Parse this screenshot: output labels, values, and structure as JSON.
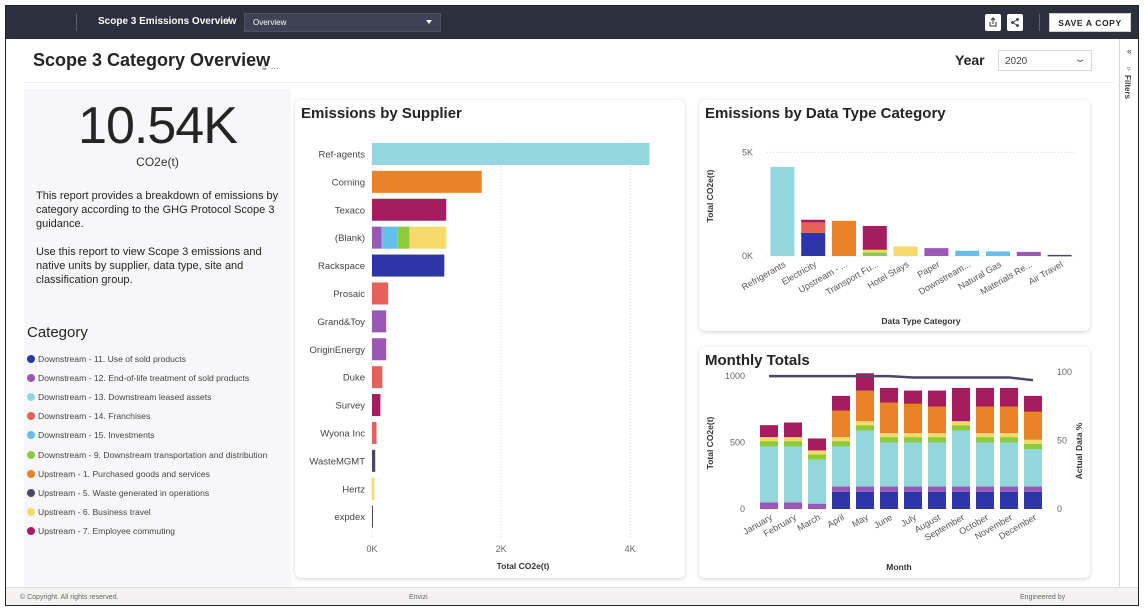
{
  "topbar": {
    "report_title": "Scope 3 Emissions Overview",
    "separator": "/",
    "page_select": "Overview",
    "save_label": "SAVE A COPY"
  },
  "page": {
    "title": "Scope 3 Category Overview",
    "year_label": "Year",
    "year_value": "2020"
  },
  "filters_pane": {
    "label": "Filters"
  },
  "kpi": {
    "value": "10.54K",
    "unit": "CO2e(t)"
  },
  "description": {
    "para1": "This report provides a breakdown of emissions by category according to the GHG Protocol Scope 3 guidance.",
    "para2": "Use this report to view Scope 3 emissions and native units by supplier, data type, site and classification group."
  },
  "category": {
    "title": "Category",
    "items": [
      {
        "label": "Downstream - 11. Use of sold products",
        "color": "#2e35a6"
      },
      {
        "label": "Downstream - 12. End-of-life treatment of sold products",
        "color": "#9b57b5"
      },
      {
        "label": "Downstream - 13. Downstream leased assets",
        "color": "#93d6de"
      },
      {
        "label": "Downstream - 14. Franchises",
        "color": "#e5625b"
      },
      {
        "label": "Downstream - 15. Investments",
        "color": "#64c0e8"
      },
      {
        "label": "Downstream - 9. Downstream transportation and distribution",
        "color": "#8ccc3c"
      },
      {
        "label": "Upstream - 1. Purchased goods and services",
        "color": "#e8832a"
      },
      {
        "label": "Upstream - 5. Waste generated in operations",
        "color": "#4b4866"
      },
      {
        "label": "Upstream - 6. Business travel",
        "color": "#f6d96b"
      },
      {
        "label": "Upstream - 7. Employee commuting",
        "color": "#a51d5f"
      }
    ]
  },
  "colors": {
    "d11": "#2e35a6",
    "d12": "#9b57b5",
    "d13": "#93d6de",
    "d14": "#e5625b",
    "d15": "#64c0e8",
    "d9": "#8ccc3c",
    "u1": "#e8832a",
    "u5": "#4b4866",
    "u6": "#f6d96b",
    "u7": "#a51d5f",
    "topbar": "#2b2f3e",
    "grid": "#d8d8d8",
    "line": "#4b4866"
  },
  "chart_data": [
    {
      "type": "bar",
      "orientation": "horizontal",
      "title": "Emissions by Supplier",
      "xlabel": "Total CO2e(t)",
      "xlim": [
        0,
        4500
      ],
      "xticks": [
        0,
        2000,
        4000
      ],
      "xtick_labels": [
        "0K",
        "2K",
        "4K"
      ],
      "categories": [
        "Ref-agents",
        "Corning",
        "Texaco",
        "(Blank)",
        "Rackspace",
        "Prosaic",
        "Grand&Toy",
        "OriginEnergy",
        "Duke",
        "Survey",
        "Wyona Inc",
        "WasteMGMT",
        "Hertz",
        "expdex"
      ],
      "segments": [
        [
          {
            "cat": "d13",
            "value": 4300
          }
        ],
        [
          {
            "cat": "u1",
            "value": 1700
          }
        ],
        [
          {
            "cat": "u7",
            "value": 1150
          }
        ],
        [
          {
            "cat": "d12",
            "value": 150
          },
          {
            "cat": "d15",
            "value": 250
          },
          {
            "cat": "d9",
            "value": 180
          },
          {
            "cat": "u6",
            "value": 570
          }
        ],
        [
          {
            "cat": "d11",
            "value": 1120
          }
        ],
        [
          {
            "cat": "d14",
            "value": 250
          }
        ],
        [
          {
            "cat": "d12",
            "value": 220
          }
        ],
        [
          {
            "cat": "d12",
            "value": 220
          }
        ],
        [
          {
            "cat": "d14",
            "value": 160
          }
        ],
        [
          {
            "cat": "u7",
            "value": 130
          }
        ],
        [
          {
            "cat": "d14",
            "value": 70
          }
        ],
        [
          {
            "cat": "u5",
            "value": 50
          }
        ],
        [
          {
            "cat": "u6",
            "value": 35
          }
        ],
        [
          {
            "cat": "u5",
            "value": 5
          }
        ]
      ]
    },
    {
      "type": "bar",
      "orientation": "vertical",
      "title": "Emissions by Data Type Category",
      "xlabel": "Data Type Category",
      "ylabel": "Total CO2e(t)",
      "ylim": [
        0,
        5500
      ],
      "yticks": [
        0,
        5000
      ],
      "ytick_labels": [
        "0K",
        "5K"
      ],
      "categories": [
        "Refrigerants",
        "Electricity",
        "Upstream - ...",
        "Transport Fu...",
        "Hotel Stays",
        "Paper",
        "Downstream...",
        "Natural Gas",
        "Materials Re...",
        "Air Travel"
      ],
      "segments": [
        [
          {
            "cat": "d13",
            "value": 4300
          }
        ],
        [
          {
            "cat": "d11",
            "value": 1120
          },
          {
            "cat": "d14",
            "value": 500
          },
          {
            "cat": "u7",
            "value": 130
          }
        ],
        [
          {
            "cat": "u1",
            "value": 1700
          }
        ],
        [
          {
            "cat": "d9",
            "value": 180
          },
          {
            "cat": "u6",
            "value": 120
          },
          {
            "cat": "u7",
            "value": 1150
          }
        ],
        [
          {
            "cat": "u6",
            "value": 460
          }
        ],
        [
          {
            "cat": "d12",
            "value": 380
          }
        ],
        [
          {
            "cat": "d15",
            "value": 250
          }
        ],
        [
          {
            "cat": "d15",
            "value": 220
          }
        ],
        [
          {
            "cat": "d12",
            "value": 200
          }
        ],
        [
          {
            "cat": "u5",
            "value": 55
          }
        ]
      ]
    },
    {
      "type": "bar",
      "subtype": "stacked-with-line",
      "title": "Monthly Totals",
      "xlabel": "Month",
      "ylabel": "Total CO2e(t)",
      "y2label": "Actual Data %",
      "ylim": [
        0,
        1200
      ],
      "yticks": [
        0,
        500,
        1000
      ],
      "y2lim": [
        0,
        110
      ],
      "y2ticks": [
        0,
        50,
        100
      ],
      "categories": [
        "January",
        "February",
        "March",
        "April",
        "May",
        "June",
        "July",
        "August",
        "September",
        "October",
        "November",
        "December"
      ],
      "stack_order": [
        "d11",
        "d12",
        "d13",
        "d9",
        "u6",
        "u1",
        "u7"
      ],
      "series": [
        {
          "cat": "d11",
          "values": [
            0,
            0,
            0,
            130,
            130,
            130,
            130,
            130,
            130,
            130,
            130,
            130
          ]
        },
        {
          "cat": "d12",
          "values": [
            50,
            50,
            40,
            40,
            40,
            40,
            40,
            40,
            40,
            40,
            40,
            40
          ]
        },
        {
          "cat": "d13",
          "values": [
            420,
            420,
            330,
            300,
            420,
            330,
            330,
            330,
            420,
            330,
            330,
            280
          ]
        },
        {
          "cat": "d9",
          "values": [
            40,
            40,
            40,
            40,
            40,
            40,
            40,
            40,
            40,
            40,
            40,
            40
          ]
        },
        {
          "cat": "u6",
          "values": [
            30,
            30,
            30,
            30,
            30,
            30,
            30,
            30,
            30,
            30,
            30,
            30
          ]
        },
        {
          "cat": "u1",
          "values": [
            0,
            0,
            0,
            200,
            230,
            230,
            220,
            200,
            0,
            200,
            200,
            210
          ]
        },
        {
          "cat": "u7",
          "values": [
            90,
            110,
            90,
            110,
            130,
            110,
            100,
            120,
            250,
            140,
            140,
            120
          ]
        }
      ],
      "line": {
        "name": "Actual Data %",
        "values": [
          97,
          97,
          97,
          97,
          97,
          97,
          96,
          96,
          96,
          96,
          96,
          94
        ]
      }
    }
  ],
  "footer": {
    "copyright": "© Copyright. All rights reserved.",
    "center": "Envizi",
    "right": "Engineered by"
  }
}
